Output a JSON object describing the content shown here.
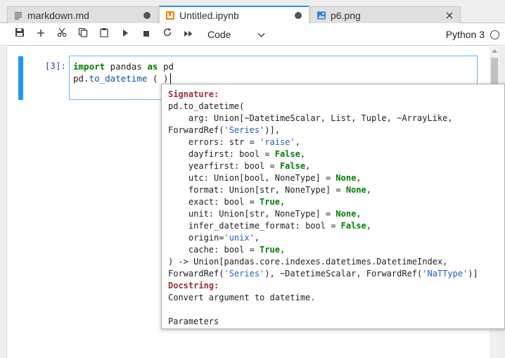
{
  "tabs": [
    {
      "label": "markdown.md",
      "icon": "markdown-file-icon",
      "status": "unsaved-dot"
    },
    {
      "label": "Untitled.ipynb",
      "icon": "notebook-icon",
      "status": "unsaved-dot"
    },
    {
      "label": "p6.png",
      "icon": "image-file-icon",
      "status": "close"
    }
  ],
  "toolbar": {
    "buttons": [
      "save-icon",
      "add-cell-icon",
      "cut-icon",
      "copy-icon",
      "paste-icon",
      "run-icon",
      "stop-icon",
      "restart-icon",
      "fast-forward-icon"
    ],
    "cell_type": "Code",
    "kernel": "Python 3"
  },
  "cell": {
    "prompt": "[3]:",
    "line1": {
      "kw1": "import",
      "mod": " pandas ",
      "kw2": "as",
      "alias": " pd"
    },
    "line2": {
      "prefix": "pd.",
      "func": "to_datetime",
      "paren": " ( )"
    }
  },
  "tooltip": {
    "signature_header": "Signature:",
    "sig_open": "pd.to_datetime(",
    "arg_a": "    arg: Union[~DatetimeScalar, List, Tuple, ~ArrayLike,",
    "arg_b_pre": "ForwardRef(",
    "arg_b_str": "'Series'",
    "arg_b_post": ")],",
    "errors_pre": "    errors: str = ",
    "errors_val": "'raise'",
    "dayfirst_pre": "    dayfirst: bool = ",
    "dayfirst_val": "False",
    "yearfirst_pre": "    yearfirst: bool = ",
    "yearfirst_val": "False",
    "utc_pre": "    utc: Union[bool, NoneType] = ",
    "utc_val": "None",
    "format_pre": "    format: Union[str, NoneType] = ",
    "format_val": "None",
    "exact_pre": "    exact: bool = ",
    "exact_val": "True",
    "unit_pre": "    unit: Union[str, NoneType] = ",
    "unit_val": "None",
    "infer_pre": "    infer_datetime_format: bool = ",
    "infer_val": "False",
    "origin_pre": "    origin=",
    "origin_val": "'unix'",
    "cache_pre": "    cache: bool = ",
    "cache_val": "True",
    "ret_a": ") -> Union[pandas.core.indexes.datetimes.DatetimeIndex,",
    "ret_b_1": "ForwardRef(",
    "ret_b_s1": "'Series'",
    "ret_b_2": "), ~DatetimeScalar, ForwardRef(",
    "ret_b_s2": "'NaTType'",
    "ret_b_3": ")]",
    "docstring_header": "Docstring:",
    "doc_line": "Convert argument to datetime.",
    "params_header": "Parameters"
  },
  "colors": {
    "accent": "#2196f3",
    "keyword": "#008000",
    "string": "#1f5fbf",
    "header": "#a0303a"
  }
}
